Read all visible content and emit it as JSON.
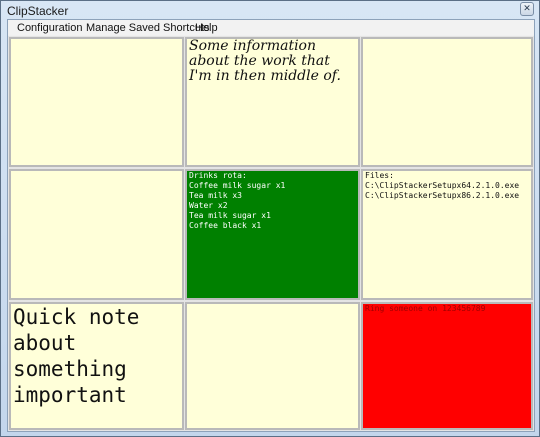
{
  "window": {
    "title": "ClipStacker",
    "close_glyph": "✕"
  },
  "menu": {
    "items": [
      {
        "label": "Configuration"
      },
      {
        "label": "Manage Saved Shortcuts"
      },
      {
        "label": "Help"
      }
    ]
  },
  "colors": {
    "default_cell": "#ffffd9",
    "green_cell": "#008000",
    "red_cell": "#ff0000",
    "white_text": "#ffffff",
    "black_text": "#111111"
  },
  "cells": [
    {
      "text": ""
    },
    {
      "text": "Some information about the work that I'm in then middle of."
    },
    {
      "text": ""
    },
    {
      "text": ""
    },
    {
      "text": "Drinks rota:\nCoffee milk sugar x1\nTea milk x3\nWater x2\nTea milk sugar x1\nCoffee black x1"
    },
    {
      "text": "Files:\nC:\\ClipStackerSetupx64.2.1.0.exe\nC:\\ClipStackerSetupx86.2.1.0.exe"
    },
    {
      "text": "Quick note about something important"
    },
    {
      "text": ""
    },
    {
      "text": "Ring someone on 123456789"
    }
  ]
}
